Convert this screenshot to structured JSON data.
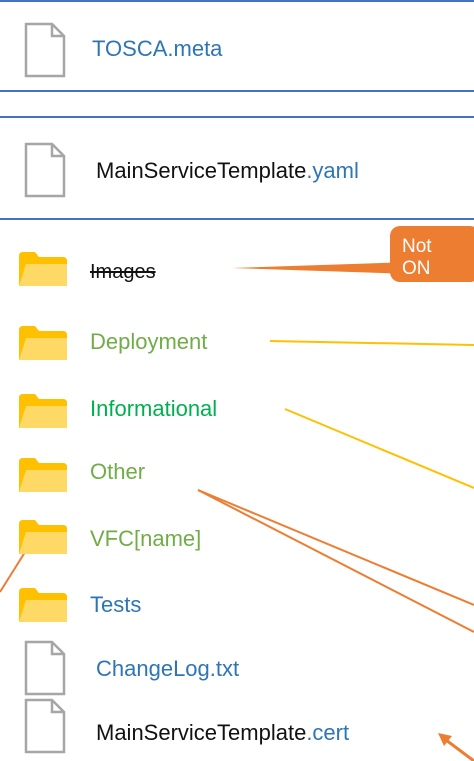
{
  "files": {
    "tosca_meta": "TOSCA.meta",
    "main_template_base": "MainServiceTemplate",
    "main_template_ext": ".yaml",
    "changelog": "ChangeLog.txt",
    "cert_base": "MainServiceTemplate",
    "cert_ext": ".cert"
  },
  "folders": {
    "images": "Images",
    "deployment": "Deployment",
    "informational": "Informational",
    "other": "Other",
    "vfc": "VFC[name]",
    "tests": "Tests"
  },
  "callout": {
    "line1": "Not",
    "line2": "ON"
  },
  "colors": {
    "frame": "#4472c4",
    "folder": "#ffc000",
    "callout": "#ed7d31",
    "connector_orange": "#ed7d31",
    "connector_yellow": "#ffc000"
  },
  "icons": {
    "file": "document-icon",
    "folder": "folder-icon"
  }
}
